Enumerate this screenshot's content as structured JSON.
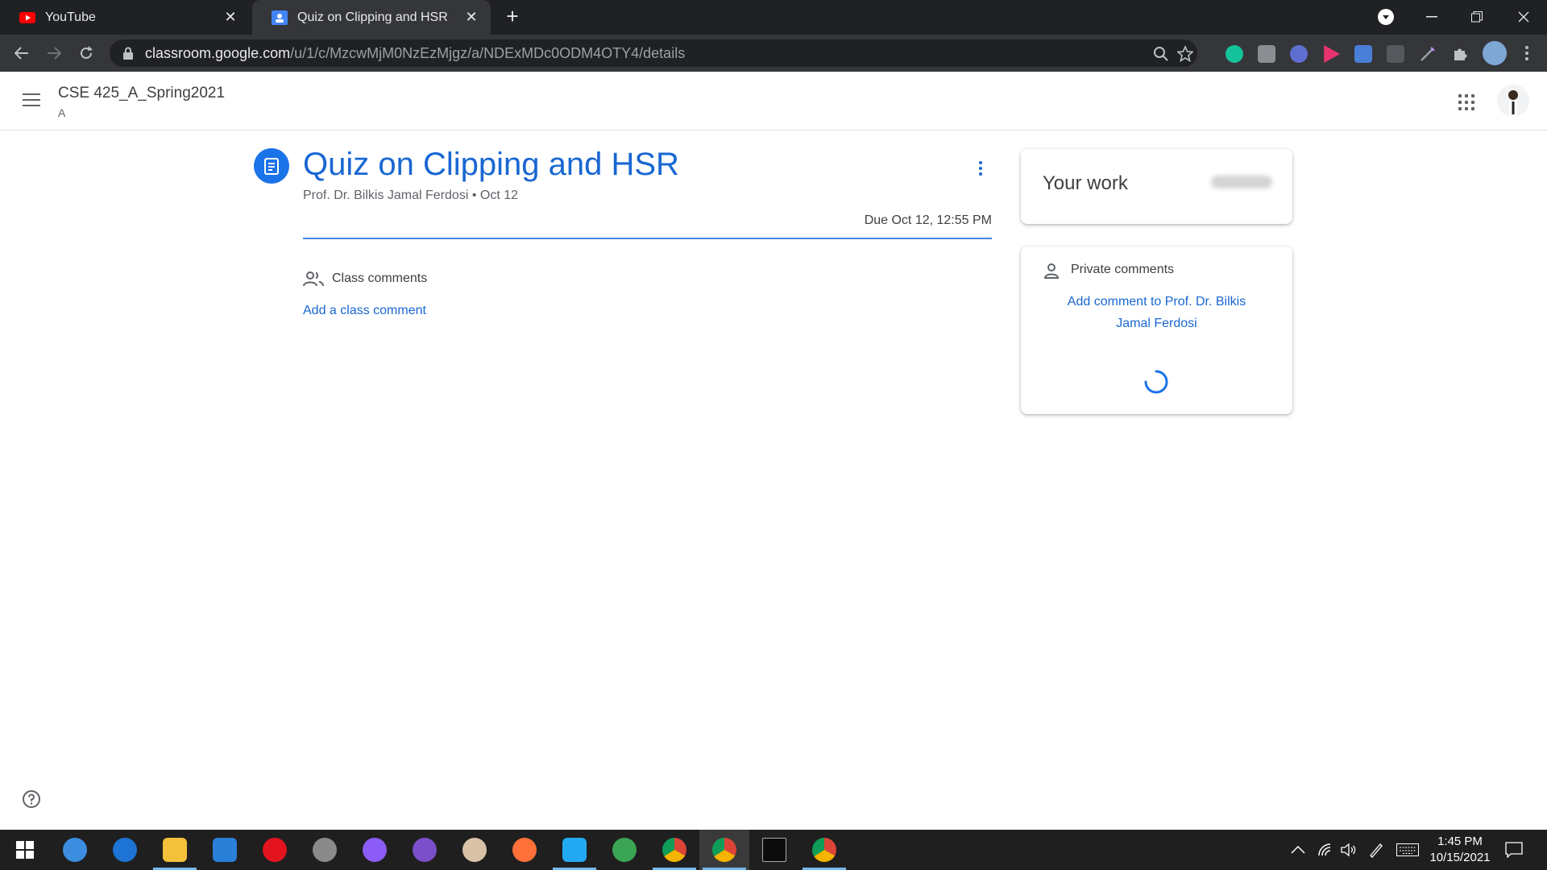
{
  "browser": {
    "tabs": [
      {
        "title": "YouTube",
        "active": false,
        "icon": "youtube-icon"
      },
      {
        "title": "Quiz on Clipping and HSR",
        "active": true,
        "icon": "classroom-icon"
      }
    ],
    "url_host": "classroom.google.com",
    "url_path": "/u/1/c/MzcwMjM0NzEzMjgz/a/NDExMDc0ODM4OTY4/details",
    "extensions": [
      "grammarly-icon",
      "camera-icon",
      "extension-icon",
      "play-icon",
      "download-icon",
      "screen-icon",
      "pen-icon",
      "puzzle-icon"
    ]
  },
  "app_header": {
    "class_name": "CSE 425_A_Spring2021",
    "section": "A"
  },
  "assignment": {
    "title": "Quiz on Clipping and HSR",
    "meta": "Prof. Dr. Bilkis Jamal Ferdosi • Oct 12",
    "due": "Due Oct 12, 12:55 PM"
  },
  "class_comments": {
    "label": "Class comments",
    "add_label": "Add a class comment"
  },
  "your_work": {
    "title": "Your work"
  },
  "private_comments": {
    "label": "Private comments",
    "add_label": "Add comment to Prof. Dr. Bilkis Jamal Ferdosi"
  },
  "taskbar": {
    "time": "1:45 PM",
    "date": "10/15/2021",
    "apps": [
      "qbittorrent-icon",
      "edge-icon",
      "file-explorer-icon",
      "mail-icon",
      "opera-icon",
      "app-icon",
      "messenger-icon",
      "github-icon",
      "app2-icon",
      "firefox-icon",
      "vscode-icon",
      "app3-icon",
      "chrome-icon",
      "chrome-active-icon",
      "terminal-icon",
      "chrome-alt-icon"
    ]
  },
  "colors": {
    "accent": "#1967d2",
    "chrome_dark": "#202124",
    "taskbar": "#1f1f1f"
  }
}
